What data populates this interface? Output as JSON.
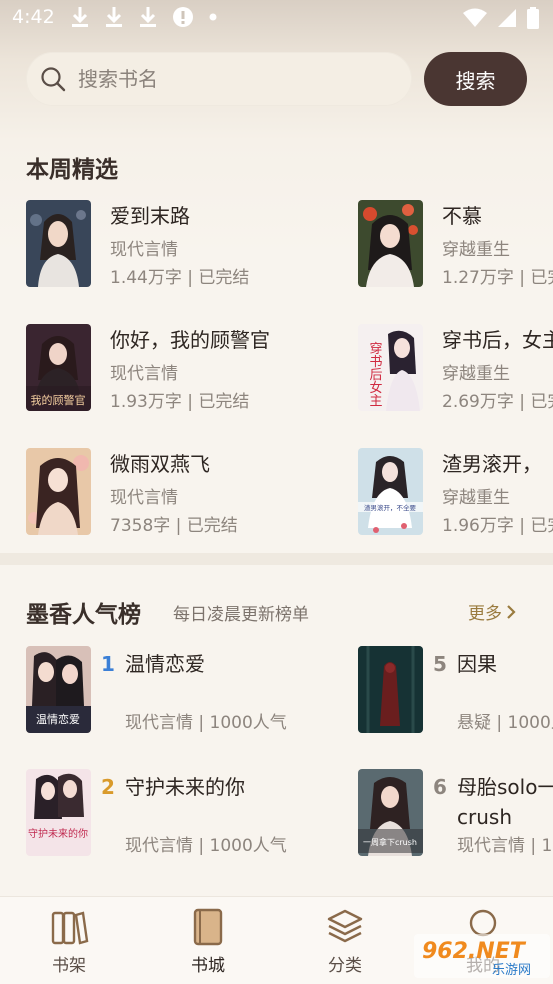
{
  "status_bar": {
    "time": "4:42",
    "left_icons": [
      "download-icon",
      "download-icon",
      "download-icon",
      "alert-icon",
      "dot-icon"
    ],
    "right_icons": [
      "wifi-icon",
      "signal-icon",
      "battery-icon"
    ]
  },
  "search": {
    "placeholder": "搜索书名",
    "button_label": "搜索"
  },
  "weekly": {
    "title": "本周精选",
    "books": [
      {
        "title": "爱到末路",
        "genre": "现代言情",
        "meta": "1.44万字 | 已完结"
      },
      {
        "title": "不慕",
        "genre": "穿越重生",
        "meta": "1.27万字 | 已完"
      },
      {
        "title": "你好，我的顾警官",
        "genre": "现代言情",
        "meta": "1.93万字 | 已完结",
        "cover_text": "我的顾警官"
      },
      {
        "title": "穿书后，女主",
        "genre": "穿越重生",
        "meta": "2.69万字 | 已完",
        "cover_text": "穿书后女主"
      },
      {
        "title": "微雨双燕飞",
        "genre": "现代言情",
        "meta": "7358字 | 已完结"
      },
      {
        "title": "渣男滚开，",
        "genre": "穿越重生",
        "meta": "1.96万字 | 已完",
        "cover_text": "渣男滚开，不全要"
      }
    ]
  },
  "ranking": {
    "title": "墨香人气榜",
    "subtitle": "每日凌晨更新榜单",
    "more": "更多",
    "items": [
      {
        "rank": "1",
        "title": "温情恋爱",
        "meta": "现代言情 | 1000人气",
        "cover_text": "温情恋爱",
        "rank_color": "#3b7fd6"
      },
      {
        "rank": "5",
        "title": "因果",
        "meta": "悬疑 | 1000人",
        "rank_color": "#8d857e"
      },
      {
        "rank": "2",
        "title": "守护未来的你",
        "meta": "现代言情 | 1000人气",
        "cover_text": "守护未来的你",
        "rank_color": "#d99a2b"
      },
      {
        "rank": "6",
        "title": "母胎solo一\ncrush",
        "meta": "现代言情 | 1",
        "cover_text": "一周拿下crush",
        "rank_color": "#8d857e"
      }
    ]
  },
  "bottom_nav": [
    {
      "label": "书架",
      "icon": "bookshelf-icon"
    },
    {
      "label": "书城",
      "icon": "book-icon"
    },
    {
      "label": "分类",
      "icon": "layers-icon"
    },
    {
      "label": "我的",
      "icon": "profile-icon"
    }
  ],
  "watermark": {
    "brand": "962.NET",
    "sub": "乐游网"
  }
}
